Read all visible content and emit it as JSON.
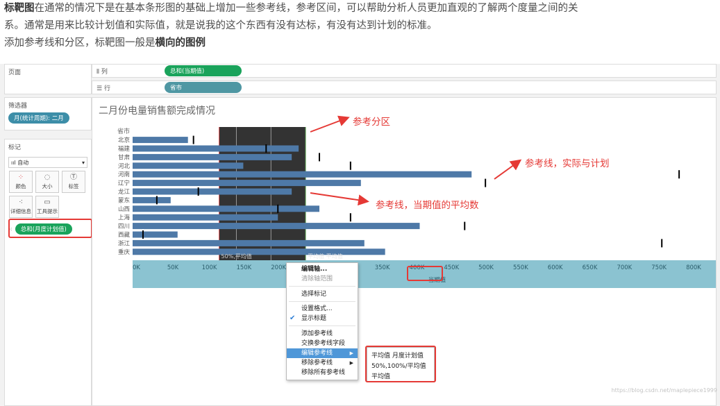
{
  "article": {
    "p1_bold": "标靶图",
    "p1_text": "在通常的情况下是在基本条形图的基础上增加一些参考线，参考区间，可以帮助分析人员更加直观的了解两个度量之间的关",
    "p1_cont": "系。通常是用来比较计划值和实际值，就是说我的这个东西有没有达标，有没有达到计划的标准。",
    "p2_text": "添加参考线和分区，标靶图一般是",
    "p2_bold": "横向的图例"
  },
  "left_panel": {
    "pages_title": "页面",
    "filters_title": "筛选器",
    "filter_pill": "月(统计周期): 二月",
    "marks_title": "标记",
    "marks_type": "自动",
    "mark_buttons": [
      "颜色",
      "大小",
      "标签",
      "详细信息",
      "工具提示"
    ],
    "mark_field_pill": "总和(月度计划值)"
  },
  "shelves": {
    "columns_label": "列",
    "columns_pill": "总和(当期值)",
    "rows_label": "行",
    "rows_pill": "省市"
  },
  "sheet": {
    "title": "二月份电量销售额完成情况"
  },
  "chart_data": {
    "type": "bar",
    "orientation": "horizontal",
    "row_header": "省市",
    "categories": [
      "北京",
      "福建",
      "甘肃",
      "河北",
      "河南",
      "辽宁",
      "龙江",
      "蒙东",
      "山西",
      "上海",
      "四川",
      "西藏",
      "浙江",
      "重庆"
    ],
    "series": [
      {
        "values": [
          80000,
          240000,
          230000,
          160000,
          490000,
          330000,
          230000,
          55000,
          270000,
          210000,
          415000,
          65000,
          335000,
          365000
        ]
      },
      {
        "values": [
          88000,
          193000,
          270000,
          315000,
          790000,
          510000,
          95000,
          35000,
          210000,
          315000,
          480000,
          15000,
          765000,
          0
        ]
      }
    ],
    "reference_band": [
      125000,
      250000
    ],
    "reference_band_lines": [
      150000,
      200000
    ],
    "band_labels": [
      "50%,平均值",
      "平均值 平均值"
    ],
    "xlim": [
      0,
      820000
    ],
    "x_ticks": [
      0,
      50000,
      100000,
      150000,
      200000,
      250000,
      300000,
      350000,
      400000,
      450000,
      500000,
      550000,
      600000,
      650000,
      700000,
      750000,
      800000
    ],
    "x_tick_labels": [
      "0K",
      "50K",
      "100K",
      "150K",
      "200K",
      "250K",
      "300K",
      "350K",
      "400K",
      "450K",
      "500K",
      "550K",
      "600K",
      "650K",
      "700K",
      "750K",
      "800K"
    ],
    "xlabel": "当期值",
    "colors": {
      "bar": "#4e79a7",
      "band": "#333333",
      "axis": "#8bc3d1",
      "marker": "#000000"
    }
  },
  "annotations": {
    "band": "参考分区",
    "plan": "参考线，实际与计划",
    "avg": "参考线，当期值的平均数"
  },
  "context_menu": {
    "items": [
      "编辑轴...",
      "清除轴范围",
      "选择标记",
      "设置格式...",
      "显示标题",
      "添加参考线",
      "交换参考线字段",
      "编辑参考线",
      "移除参考线",
      "移除所有参考线"
    ]
  },
  "submenu": {
    "items": [
      "平均值 月度计划值",
      "50%,100%/平均值",
      "平均值"
    ]
  },
  "watermark": "https://blog.csdn.net/maplepiece1999"
}
